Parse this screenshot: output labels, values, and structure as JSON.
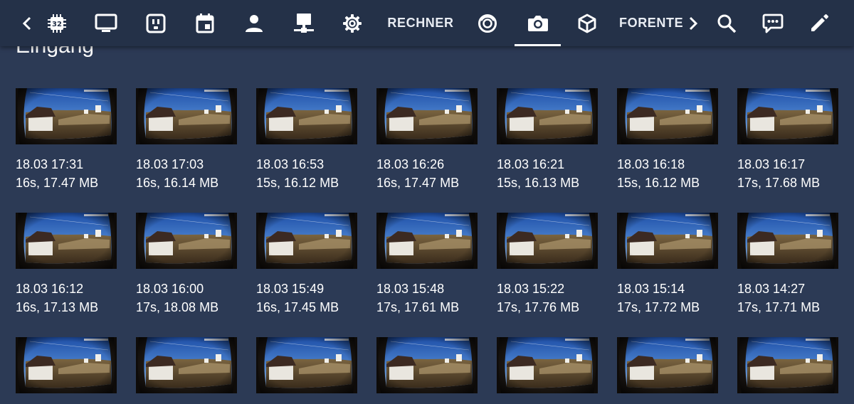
{
  "topbar": {
    "items": [
      {
        "name": "back-chevron-icon",
        "type": "icon"
      },
      {
        "name": "cpu-chip-icon",
        "type": "icon"
      },
      {
        "name": "monitor-icon",
        "type": "icon"
      },
      {
        "name": "power-socket-icon",
        "type": "icon"
      },
      {
        "name": "calendar-icon",
        "type": "icon"
      },
      {
        "name": "person-icon",
        "type": "icon"
      },
      {
        "name": "network-computer-icon",
        "type": "icon"
      },
      {
        "name": "settings-gear-icon",
        "type": "icon"
      },
      {
        "name": "tab-rechner",
        "type": "text",
        "label": "RECHNER"
      },
      {
        "name": "robot-vacuum-icon",
        "type": "icon"
      },
      {
        "name": "camera-icon",
        "type": "icon",
        "active": true
      },
      {
        "name": "cube-icon",
        "type": "icon"
      },
      {
        "name": "tab-forente",
        "type": "text",
        "label": "FORENTE"
      },
      {
        "name": "forward-chevron-icon",
        "type": "icon"
      },
      {
        "name": "search-icon",
        "type": "icon"
      },
      {
        "name": "assist-chat-icon",
        "type": "icon"
      },
      {
        "name": "edit-pencil-icon",
        "type": "icon"
      }
    ]
  },
  "page": {
    "title": "Eingang"
  },
  "recordings": [
    {
      "time": "18.03 17:31",
      "info": "16s, 17.47 MB"
    },
    {
      "time": "18.03 17:03",
      "info": "16s, 16.14 MB"
    },
    {
      "time": "18.03 16:53",
      "info": "15s, 16.12 MB"
    },
    {
      "time": "18.03 16:26",
      "info": "16s, 17.47 MB"
    },
    {
      "time": "18.03 16:21",
      "info": "15s, 16.13 MB"
    },
    {
      "time": "18.03 16:18",
      "info": "15s, 16.12 MB"
    },
    {
      "time": "18.03 16:17",
      "info": "17s, 17.68 MB"
    },
    {
      "time": "18.03 16:12",
      "info": "16s, 17.13 MB"
    },
    {
      "time": "18.03 16:00",
      "info": "17s, 18.08 MB"
    },
    {
      "time": "18.03 15:49",
      "info": "16s, 17.45 MB"
    },
    {
      "time": "18.03 15:48",
      "info": "17s, 17.61 MB"
    },
    {
      "time": "18.03 15:22",
      "info": "17s, 17.76 MB"
    },
    {
      "time": "18.03 15:14",
      "info": "17s, 17.72 MB"
    },
    {
      "time": "18.03 14:27",
      "info": "17s, 17.71 MB"
    },
    {
      "time": "",
      "info": ""
    },
    {
      "time": "",
      "info": ""
    },
    {
      "time": "",
      "info": ""
    },
    {
      "time": "",
      "info": ""
    },
    {
      "time": "",
      "info": ""
    },
    {
      "time": "",
      "info": ""
    },
    {
      "time": "",
      "info": ""
    }
  ],
  "colors": {
    "topbar": "#243148",
    "background": "#2c3a55",
    "accent": "#ffffff"
  }
}
